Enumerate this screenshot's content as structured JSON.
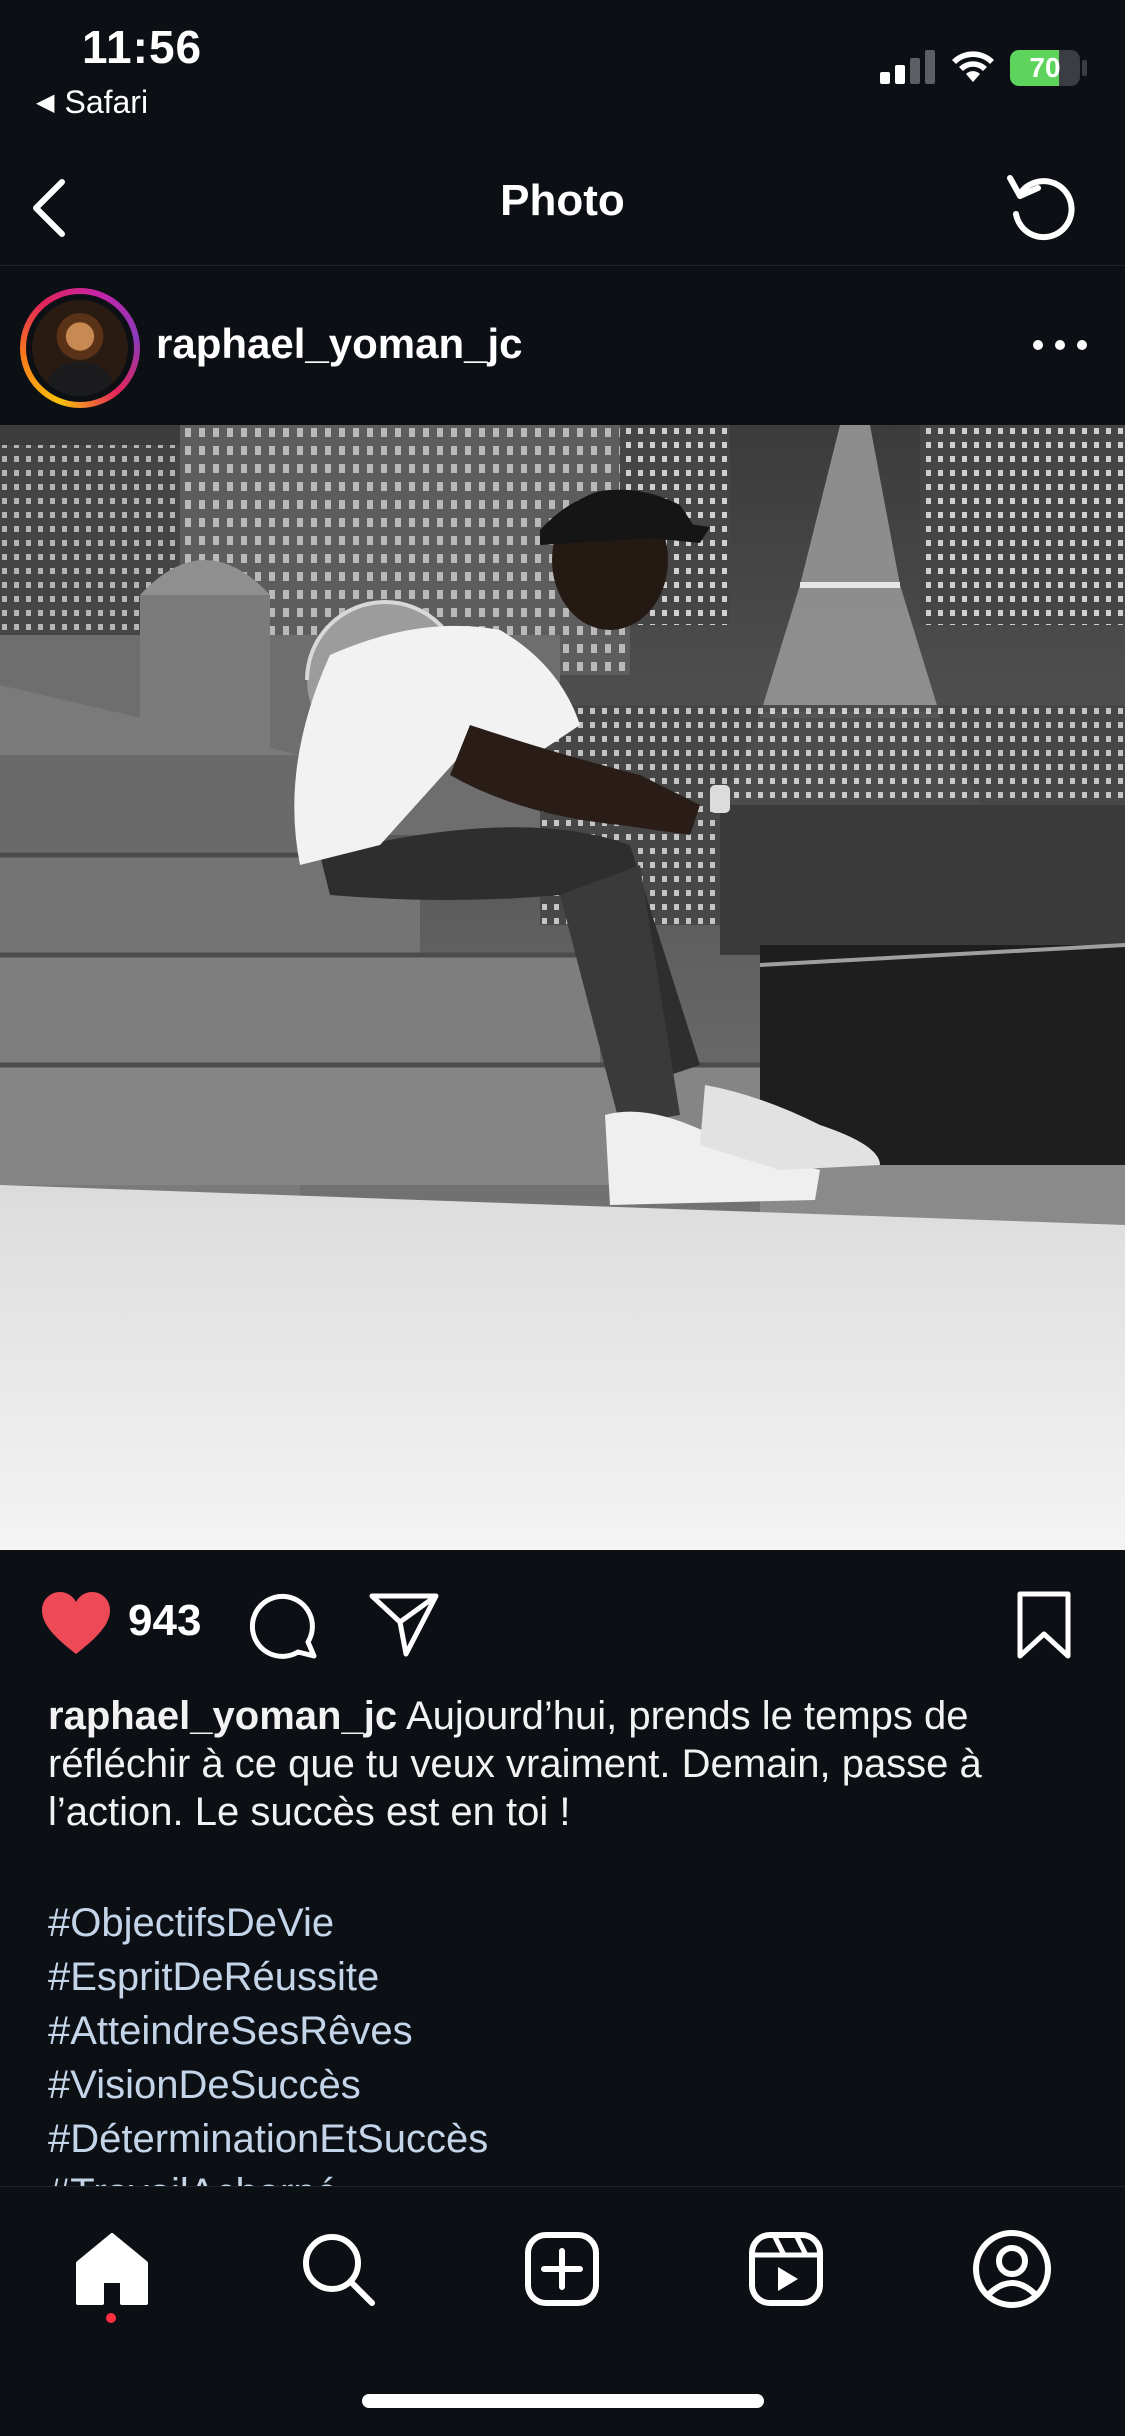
{
  "status_bar": {
    "time": "11:56",
    "back_app": "Safari",
    "battery": "70",
    "battery_color": "#5fd45c"
  },
  "nav": {
    "title": "Photo",
    "back_icon": "chevron-left-icon",
    "refresh_icon": "refresh-icon"
  },
  "post": {
    "username": "raphael_yoman_jc",
    "more_icon": "more-horizontal-icon",
    "likes": "943",
    "like_color": "#ed4956",
    "caption_user": "raphael_yoman_jc",
    "caption_text": "Aujourd’hui, prends le temps de réfléchir à ce que tu veux vraiment. Demain, passe à l’action. Le succès est en toi !",
    "hashtags": [
      "#ObjectifsDeVie",
      "#EspritDeRéussite",
      "#AtteindreSesRêves",
      "#VisionDeSuccès",
      "#DéterminationEtSuccès",
      "#TravailAcharné"
    ],
    "hashtag_color": "#c4d5ea"
  },
  "tabbar": {
    "items": [
      "home-icon",
      "search-icon",
      "create-icon",
      "reels-icon",
      "profile-icon"
    ],
    "active": "home-icon",
    "notification_color": "#ff3040"
  }
}
